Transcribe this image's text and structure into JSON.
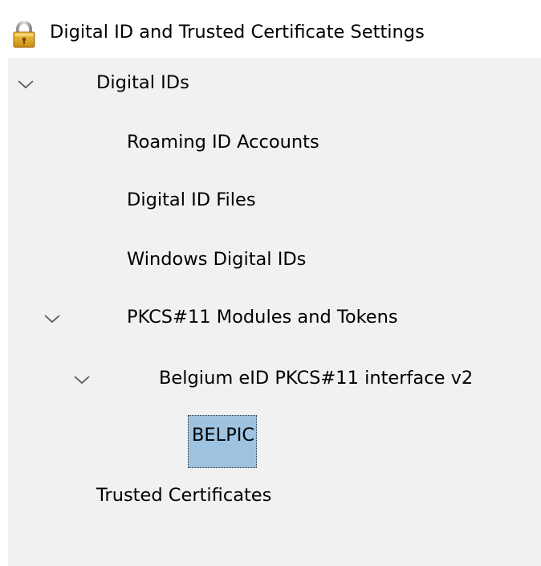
{
  "header": {
    "title": "Digital ID and Trusted Certificate Settings",
    "icon": "lock-icon"
  },
  "tree": {
    "selected_color": "#9dc3e1",
    "digital_ids": {
      "label": "Digital IDs",
      "expanded": true,
      "roaming": "Roaming ID Accounts",
      "files": "Digital ID Files",
      "windows": "Windows Digital IDs",
      "pkcs11": {
        "label": "PKCS#11 Modules and Tokens",
        "expanded": true,
        "module": {
          "label": "Belgium eID PKCS#11 interface v2",
          "expanded": true,
          "token": "BELPIC"
        }
      }
    },
    "trusted": "Trusted Certificates"
  }
}
